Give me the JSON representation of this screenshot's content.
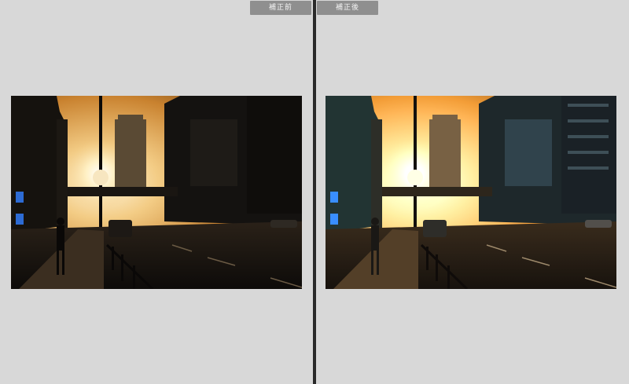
{
  "panes": {
    "before": {
      "label": "補正前"
    },
    "after": {
      "label": "補正後"
    }
  },
  "photo": {
    "description_icon": "city-sunset-photo",
    "sky_colors": [
      "#f6e2b4",
      "#eab768",
      "#c57a2a"
    ],
    "building_color": "#141210",
    "sun_color": "#fff6d6"
  }
}
